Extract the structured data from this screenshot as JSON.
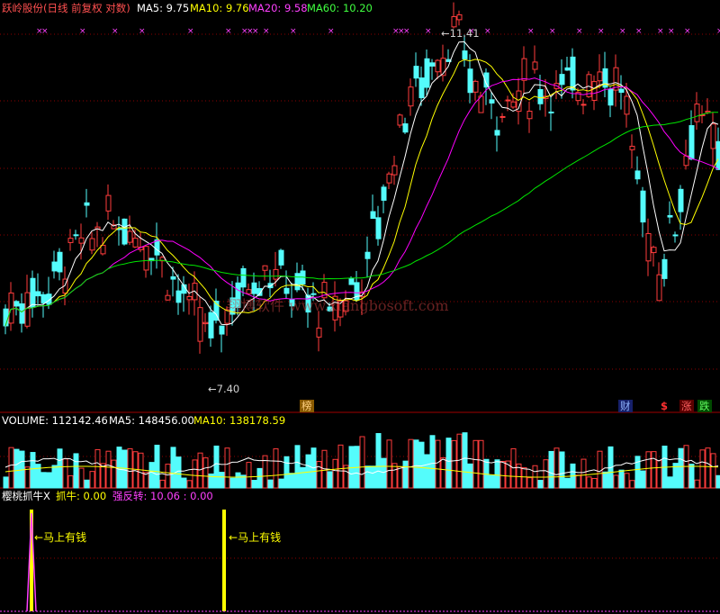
{
  "header": {
    "stock_name": "跃岭股份(日线 前复权 对数)",
    "ma5": "MA5: 9.75",
    "ma10": "MA10: 9.76",
    "ma20": "MA20: 9.58",
    "ma60": "MA60: 10.20"
  },
  "volume_header": {
    "title": "VOLUME: 112142.46",
    "ma5": "MA5: 148456.00",
    "ma10": "MA10: 138178.59"
  },
  "indicator_header": {
    "name": "樱桃抓牛X",
    "grab": "抓牛: 0.00",
    "rebound": "强反转: 10.06 : 0.00"
  },
  "annotations": {
    "high": "11.41",
    "low": "7.40",
    "signal_1": "马上有钱",
    "signal_2": "马上有钱",
    "watermark": "翔博软件 www.xiangbosoft.com"
  },
  "event_markers": [
    "榜",
    "财",
    "$",
    "涨",
    "跌"
  ],
  "colors": {
    "up": "#ff3c3c",
    "down": "#54fcfc",
    "ma5": "#ffffff",
    "ma10": "#ffff00",
    "ma20": "#ff00ff",
    "ma60": "#00e600",
    "grid": "#8b0000"
  },
  "chart_data": {
    "type": "candlestick",
    "title": "跃岭股份(日线 前复权 对数)",
    "price_range": [
      7.4,
      11.41
    ],
    "marked_high": 11.41,
    "marked_low": 7.4,
    "moving_averages": {
      "MA5": 9.75,
      "MA10": 9.76,
      "MA20": 9.58,
      "MA60": 10.2
    },
    "volume": {
      "value": 112142.46,
      "MA5": 148456.0,
      "MA10": 138178.59
    },
    "indicator": {
      "抓牛": 0.0,
      "强反转": [
        10.06,
        0.0
      ]
    }
  }
}
